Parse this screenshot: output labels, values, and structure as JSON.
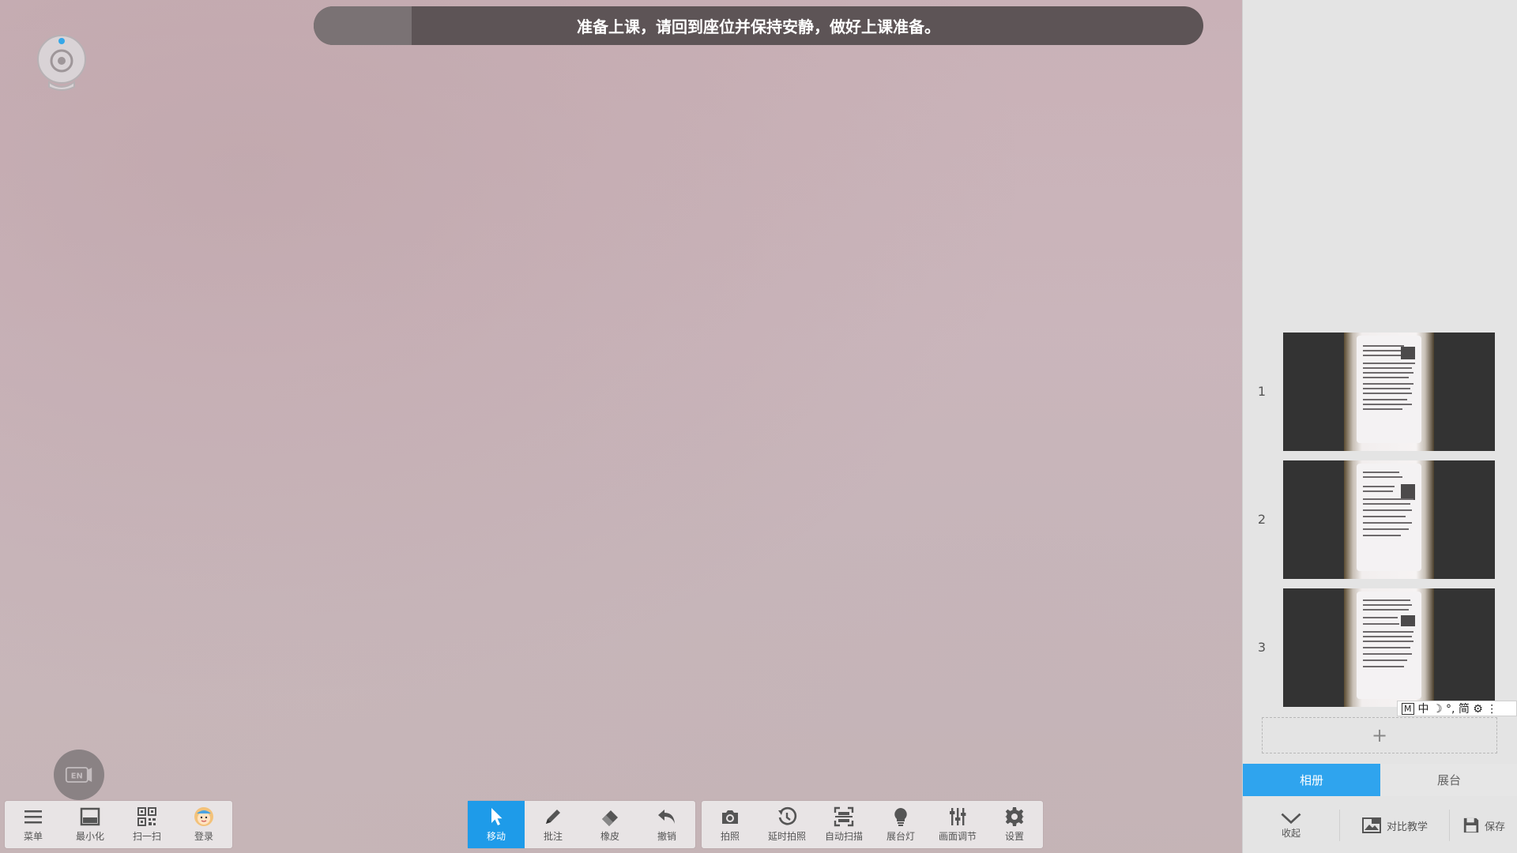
{
  "notice": {
    "text": "准备上课，请回到座位并保持安静，做好上课准备。",
    "progress_fraction": 0.11
  },
  "lang_toggle": {
    "label": "EN"
  },
  "toolbar_left": [
    {
      "label": "菜单",
      "icon": "menu-icon"
    },
    {
      "label": "最小化",
      "icon": "minimize-icon"
    },
    {
      "label": "扫一扫",
      "icon": "qrcode-icon"
    },
    {
      "label": "登录",
      "icon": "avatar-icon"
    }
  ],
  "toolbar_mid": [
    {
      "label": "移动",
      "icon": "cursor-icon",
      "active": true
    },
    {
      "label": "批注",
      "icon": "pen-icon"
    },
    {
      "label": "橡皮",
      "icon": "eraser-icon"
    },
    {
      "label": "撤销",
      "icon": "undo-icon"
    }
  ],
  "toolbar_right": [
    {
      "label": "拍照",
      "icon": "camera-icon"
    },
    {
      "label": "延时拍照",
      "icon": "timer-camera-icon"
    },
    {
      "label": "自动扫描",
      "icon": "auto-scan-icon"
    },
    {
      "label": "展台灯",
      "icon": "lamp-icon"
    },
    {
      "label": "画面调节",
      "icon": "sliders-icon"
    },
    {
      "label": "设置",
      "icon": "gear-icon"
    }
  ],
  "thumbnails": [
    {
      "number": "1"
    },
    {
      "number": "2"
    },
    {
      "number": "3"
    }
  ],
  "add_slot": {
    "label": "+"
  },
  "ime": {
    "mode": "M",
    "items": "中 ☽ °, 简 ⚙ ⋮"
  },
  "tabs": [
    {
      "label": "相册",
      "active": true
    },
    {
      "label": "展台",
      "active": false
    }
  ],
  "panel_actions": {
    "collapse": "收起",
    "compare": "对比教学",
    "save": "保存"
  },
  "colors": {
    "accent": "#1e9be9",
    "tab_active": "#2fa4ee",
    "notice_bg": "#5d5456"
  }
}
